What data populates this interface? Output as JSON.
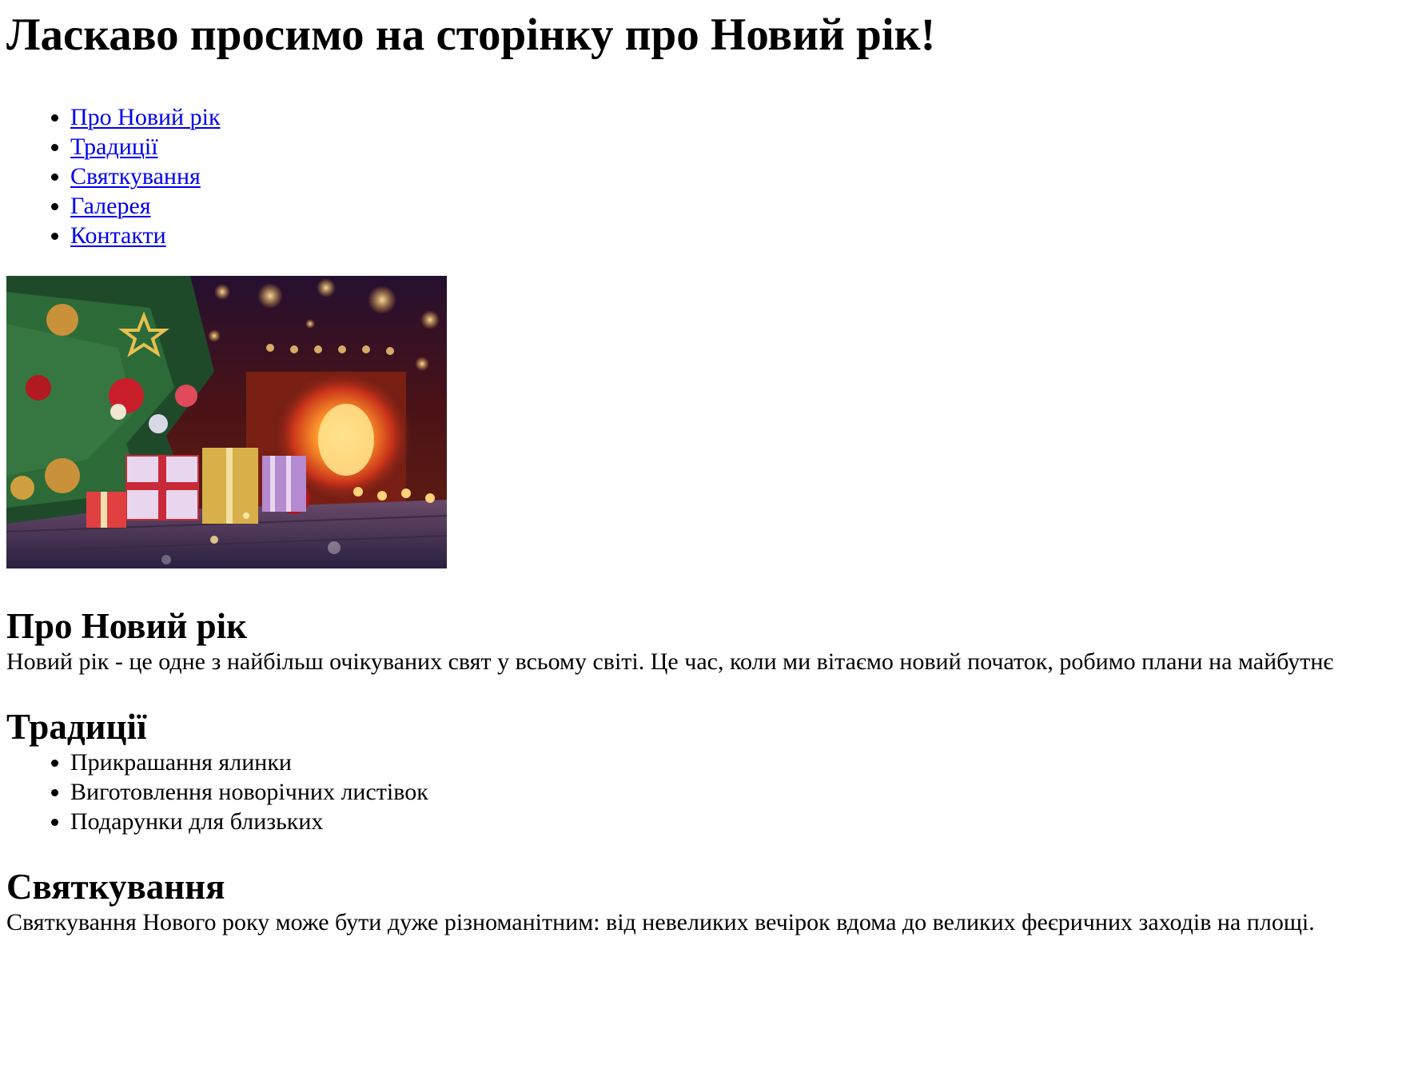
{
  "header": {
    "title": "Ласкаво просимо на сторінку про Новий рік!"
  },
  "nav": {
    "items": [
      {
        "label": "Про Новий рік"
      },
      {
        "label": "Традиції"
      },
      {
        "label": "Святкування"
      },
      {
        "label": "Галерея"
      },
      {
        "label": "Контакти"
      }
    ]
  },
  "hero_image": {
    "icon": "christmas-tree-fireplace-photo"
  },
  "about": {
    "heading": "Про Новий рік",
    "text": "Новий рік - це одне з найбільш очікуваних свят у всьому світі. Це час, коли ми вітаємо новий початок, робимо плани на майбутнє"
  },
  "traditions": {
    "heading": "Традиції",
    "items": [
      {
        "label": "Прикрашання ялинки"
      },
      {
        "label": "Виготовлення новорічних листівок"
      },
      {
        "label": "Подарунки для близьких"
      }
    ]
  },
  "celebration": {
    "heading": "Святкування",
    "text": "Святкування Нового року може бути дуже різноманітним: від невеликих вечірок вдома до великих феєричних заходів на площі."
  },
  "colors": {
    "link": "#0000ee",
    "text": "#000000",
    "background": "#ffffff"
  }
}
